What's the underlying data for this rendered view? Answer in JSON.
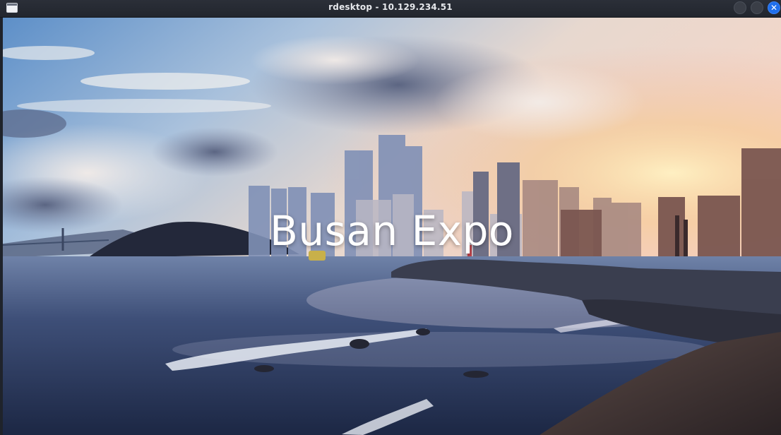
{
  "window": {
    "title": "rdesktop - 10.129.234.51",
    "icons": [
      "app-window-icon",
      "minimize-icon",
      "maximize-icon",
      "close-icon"
    ],
    "close_glyph": "✕"
  },
  "page": {
    "hero_title": "Busan Expo"
  },
  "colors": {
    "titlebar": "#22262e",
    "close_button": "#1f6feb",
    "hero_text": "#ffffff"
  }
}
